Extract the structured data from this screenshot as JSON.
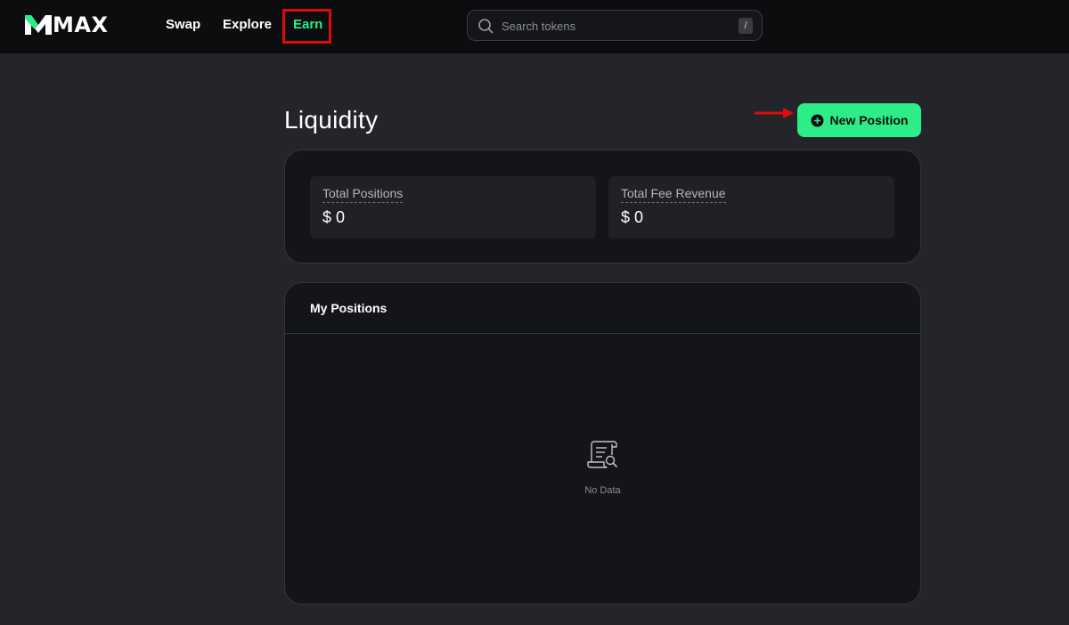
{
  "app": {
    "logo_text": "MAX"
  },
  "nav": {
    "items": [
      {
        "label": "Swap",
        "active": false
      },
      {
        "label": "Explore",
        "active": false
      },
      {
        "label": "Earn",
        "active": true
      }
    ]
  },
  "search": {
    "placeholder": "Search tokens",
    "shortcut": "/"
  },
  "page": {
    "title": "Liquidity"
  },
  "actions": {
    "new_position_label": "New Position"
  },
  "stats": {
    "total_positions": {
      "label": "Total Positions",
      "value": "$ 0"
    },
    "total_fee_revenue": {
      "label": "Total Fee Revenue",
      "value": "$ 0"
    }
  },
  "positions": {
    "title": "My Positions",
    "empty_text": "No Data"
  },
  "colors": {
    "accent": "#2dee86",
    "background": "#24252a",
    "topbar": "#0c0d0f",
    "card": "#141519",
    "annotation": "#e10a0a"
  }
}
